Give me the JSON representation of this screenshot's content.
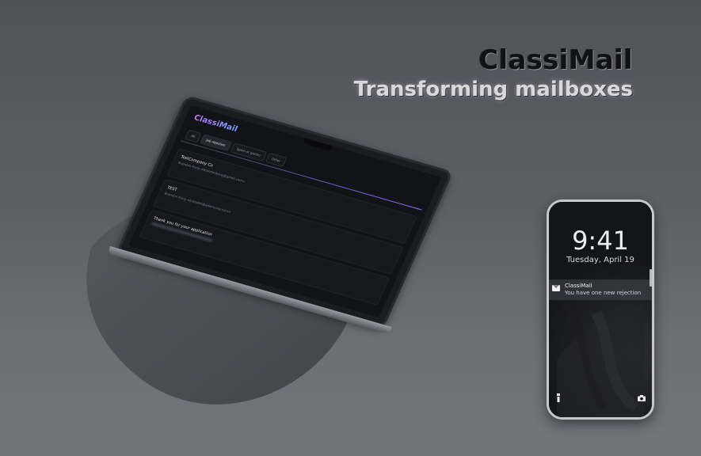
{
  "hero": {
    "title": "ClassiMail",
    "subtitle": "Transforming mailboxes"
  },
  "laptop_app": {
    "logo": "ClassiMail",
    "tabs": [
      "All",
      "Job rejection",
      "Spam or promo",
      "Other"
    ],
    "active_tab": "Job rejection",
    "emails": [
      {
        "subject": "TestCompany Co",
        "from": "Brandon Kong <brandonkong@gmail.com>"
      },
      {
        "subject": "TEST",
        "from": "Brandon Kong <brandon@adamcorp.com>"
      },
      {
        "subject": "Thank you for your application",
        "from": ""
      }
    ]
  },
  "phone": {
    "time": "9:41",
    "date": "Tuesday, April 19",
    "notification": {
      "app": "ClassiMail",
      "message": "You have one new rejection",
      "icon": "mail-icon"
    },
    "left_icon": "flashlight-icon",
    "right_icon": "camera-icon"
  },
  "colors": {
    "accent_gradient_start": "#c070ff",
    "accent_gradient_end": "#6fa0ff",
    "background": "#5a5c62"
  }
}
